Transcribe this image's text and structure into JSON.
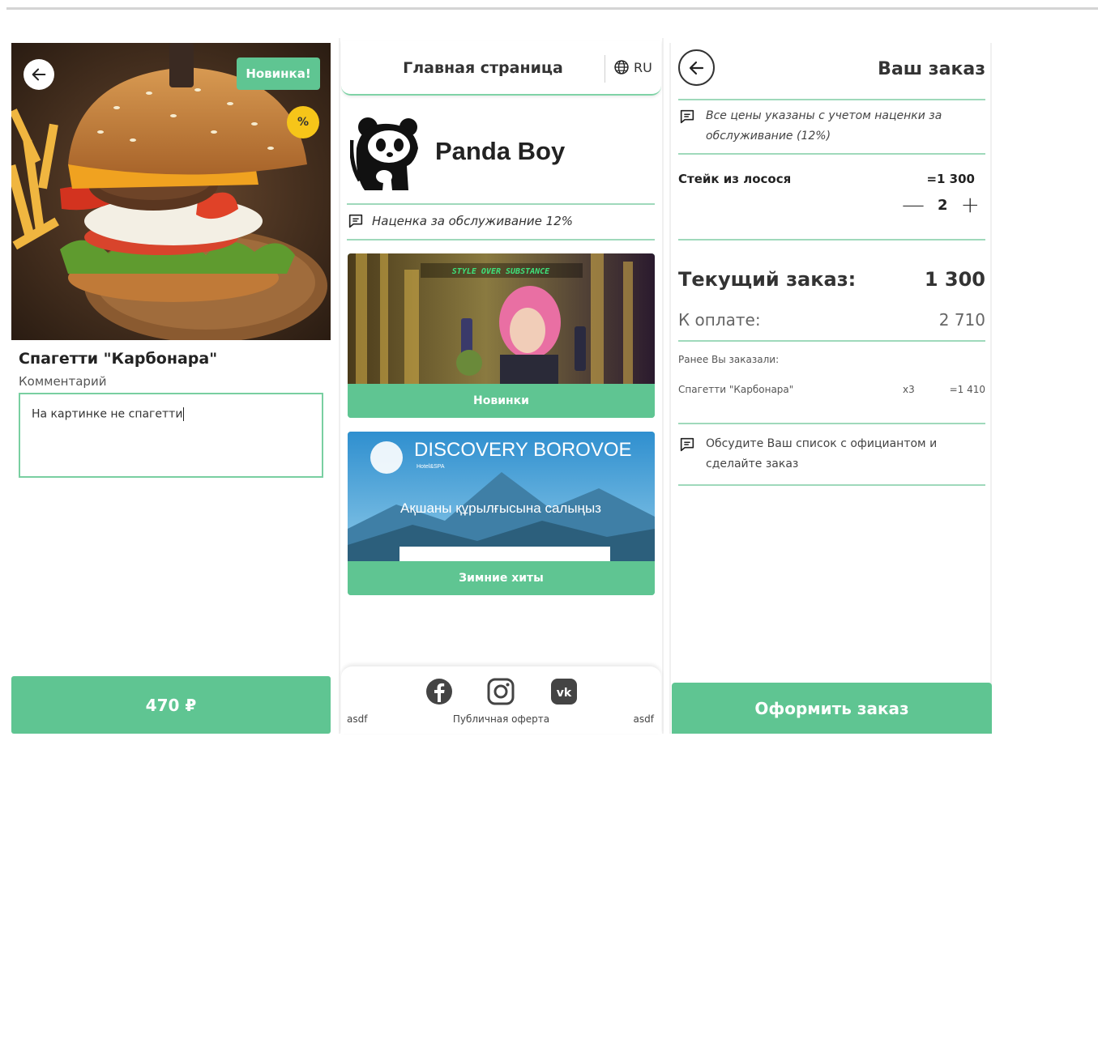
{
  "dish_panel": {
    "badge_new": "Новинка!",
    "badge_discount": "%",
    "title": "Спагетти \"Карбонара\"",
    "comment_label": "Комментарий",
    "comment_value": "На картинке не спагетти",
    "price_button": "470 ₽"
  },
  "home_panel": {
    "header_title": "Главная страница",
    "language": "RU",
    "brand_name": "Panda Boy",
    "service_note": "Наценка за обслуживание 12%",
    "promos": [
      {
        "image_text": "STYLE OVER SUBSTANCE",
        "label": "Новинки"
      },
      {
        "image_title": "DISCOVERY BOROVOE",
        "image_subtitle": "Hotel&SPA",
        "image_caption": "Ақшаны құрылғысына салыңыз",
        "label": "Зимние хиты"
      }
    ],
    "footer": {
      "left": "asdf",
      "center": "Публичная оферта",
      "right": "asdf"
    },
    "social": [
      "facebook-icon",
      "instagram-icon",
      "vk-icon"
    ]
  },
  "order_panel": {
    "title": "Ваш заказ",
    "price_note": "Все цены указаны с учетом наценки за обслуживание (12%)",
    "item": {
      "name": "Стейк из лосося",
      "price": "=1 300",
      "qty": "2"
    },
    "current_label": "Текущий заказ:",
    "current_value": "1 300",
    "pay_label": "К оплате:",
    "pay_value": "2 710",
    "previous_label": "Ранее Вы заказали:",
    "previous_item": {
      "name": "Спагетти \"Карбонара\"",
      "qty": "x3",
      "sum": "=1 410"
    },
    "waiter_note": "Обсудите Ваш список с официантом и сделайте заказ",
    "checkout_button": "Оформить заказ"
  },
  "colors": {
    "accent": "#5fc592",
    "divider": "#9fd9bb",
    "discount": "#f6c519"
  }
}
